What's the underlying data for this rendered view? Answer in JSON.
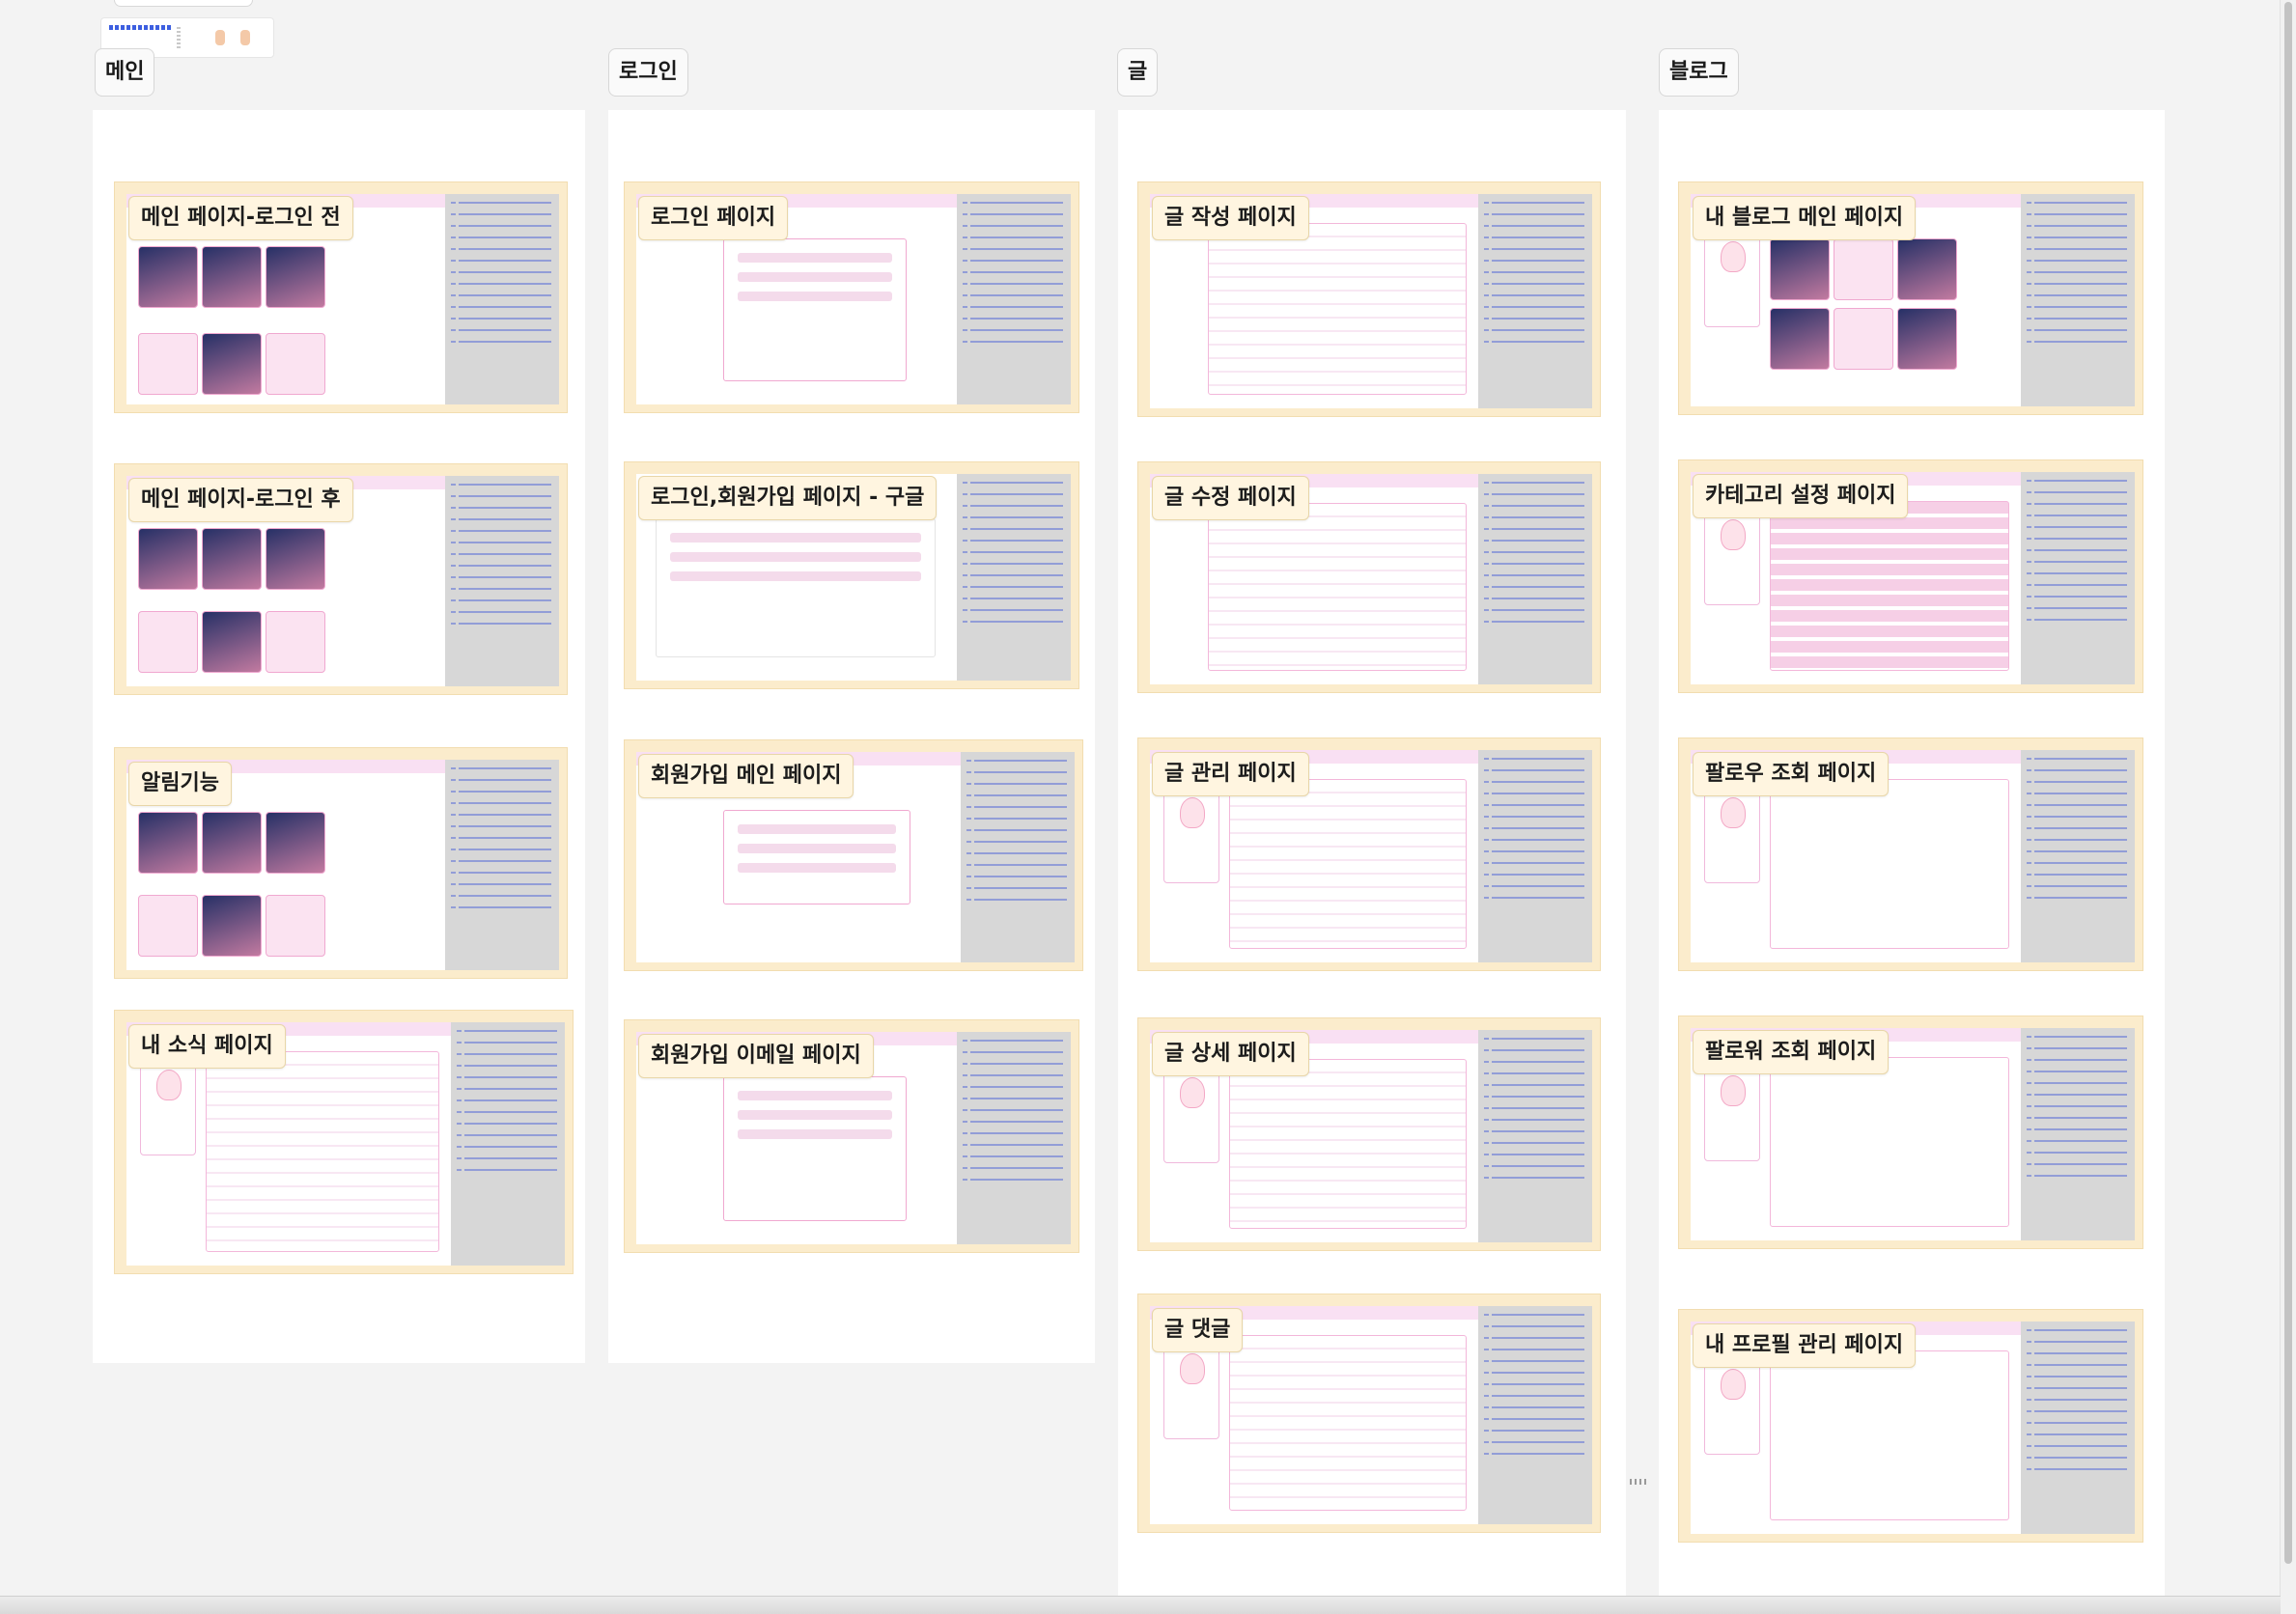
{
  "columns": [
    {
      "label": "메인",
      "cards": [
        "메인 페이지-로그인 전",
        "메인 페이지-로그인 후",
        "알림기능",
        "내 소식 페이지"
      ]
    },
    {
      "label": "로그인",
      "cards": [
        "로그인 페이지",
        "로그인,회원가입 페이지 - 구글",
        "회원가입 메인 페이지",
        "회원가입 이메일 페이지"
      ]
    },
    {
      "label": "글",
      "cards": [
        "글 작성 페이지",
        "글 수정 페이지",
        "글 관리 페이지",
        "글 상세 페이지",
        "글 댓글"
      ]
    },
    {
      "label": "블로그",
      "cards": [
        "내 블로그 메인 페이지",
        "카테고리 설정 페이지",
        "팔로우 조회 페이지",
        "팔로워 조회 페이지",
        "내 프로필 관리 페이지"
      ]
    }
  ],
  "colors": {
    "canvas": "#f3f3f3",
    "card": "#fbeccc",
    "accent_pink": "#f3b7da",
    "notes_gray": "#d7d7d7"
  }
}
